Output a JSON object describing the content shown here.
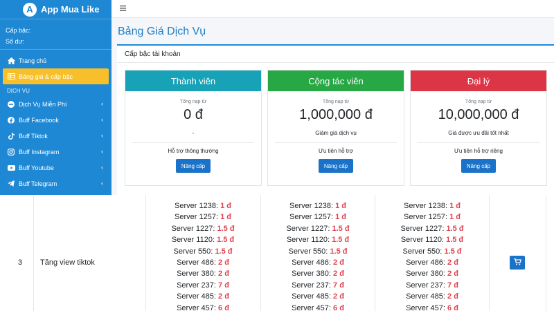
{
  "sidebar": {
    "brand_letter": "A",
    "brand_name": "App Mua Like",
    "rank_label": "Cấp bậc:",
    "balance_label": "Số dư:",
    "items_top": [
      {
        "label": "Trang chủ",
        "icon": "home-icon"
      },
      {
        "label": "Bảng giá & cấp bậc",
        "icon": "table-icon",
        "active": true
      }
    ],
    "section_label": "DỊCH VỤ",
    "items_service": [
      {
        "label": "Dịch Vụ Miễn Phí",
        "icon": "minus-circle-icon"
      },
      {
        "label": "Buff Facebook",
        "icon": "facebook-icon"
      },
      {
        "label": "Buff Tiktok",
        "icon": "tiktok-icon"
      },
      {
        "label": "Buff Instagram",
        "icon": "instagram-icon"
      },
      {
        "label": "Buff Youtube",
        "icon": "youtube-icon"
      },
      {
        "label": "Buff Telegram",
        "icon": "telegram-icon"
      }
    ]
  },
  "topbar": {
    "menu_icon": "hamburger-icon"
  },
  "page": {
    "title": "Bảng Giá Dịch Vụ",
    "card_title": "Cấp bậc tài khoản"
  },
  "tiers": [
    {
      "name": "Thành viên",
      "color": "#17a2b8",
      "sub": "Tổng nạp từ",
      "price": "0 đ",
      "desc": "-",
      "support": "Hỗ trợ thông thường",
      "button": "Nâng cấp"
    },
    {
      "name": "Cộng tác viên",
      "color": "#28a745",
      "sub": "Tổng nạp từ",
      "price": "1,000,000 đ",
      "desc": "Giảm giá dịch vụ",
      "support": "Ưu tiên hỗ trợ",
      "button": "Nâng cấp"
    },
    {
      "name": "Đại lý",
      "color": "#dc3545",
      "sub": "Tổng nạp từ",
      "price": "10,000,000 đ",
      "desc": "Giá được ưu đãi tốt nhất",
      "support": "Ưu tiên hỗ trợ riêng",
      "button": "Nâng cấp"
    }
  ],
  "table_row": {
    "number": "3",
    "service": "Tăng view tiktok",
    "cart_icon": "cart-icon",
    "price_columns": [
      [
        {
          "server": "Server 1238:",
          "price": "1 đ"
        },
        {
          "server": "Server 1257:",
          "price": "1 đ"
        },
        {
          "server": "Server 1227:",
          "price": "1.5 đ"
        },
        {
          "server": "Server 1120:",
          "price": "1.5 đ"
        },
        {
          "server": "Server 550:",
          "price": "1.5 đ"
        },
        {
          "server": "Server 486:",
          "price": "2 đ"
        },
        {
          "server": "Server 380:",
          "price": "2 đ"
        },
        {
          "server": "Server 237:",
          "price": "7 đ"
        },
        {
          "server": "Server 485:",
          "price": "2 đ"
        },
        {
          "server": "Server 457:",
          "price": "6 đ"
        }
      ],
      [
        {
          "server": "Server 1238:",
          "price": "1 đ"
        },
        {
          "server": "Server 1257:",
          "price": "1 đ"
        },
        {
          "server": "Server 1227:",
          "price": "1.5 đ"
        },
        {
          "server": "Server 1120:",
          "price": "1.5 đ"
        },
        {
          "server": "Server 550:",
          "price": "1.5 đ"
        },
        {
          "server": "Server 486:",
          "price": "2 đ"
        },
        {
          "server": "Server 380:",
          "price": "2 đ"
        },
        {
          "server": "Server 237:",
          "price": "7 đ"
        },
        {
          "server": "Server 485:",
          "price": "2 đ"
        },
        {
          "server": "Server 457:",
          "price": "6 đ"
        }
      ],
      [
        {
          "server": "Server 1238:",
          "price": "1 đ"
        },
        {
          "server": "Server 1257:",
          "price": "1 đ"
        },
        {
          "server": "Server 1227:",
          "price": "1.5 đ"
        },
        {
          "server": "Server 1120:",
          "price": "1.5 đ"
        },
        {
          "server": "Server 550:",
          "price": "1.5 đ"
        },
        {
          "server": "Server 486:",
          "price": "2 đ"
        },
        {
          "server": "Server 380:",
          "price": "2 đ"
        },
        {
          "server": "Server 237:",
          "price": "7 đ"
        },
        {
          "server": "Server 485:",
          "price": "2 đ"
        },
        {
          "server": "Server 457:",
          "price": "6 đ"
        }
      ]
    ]
  }
}
